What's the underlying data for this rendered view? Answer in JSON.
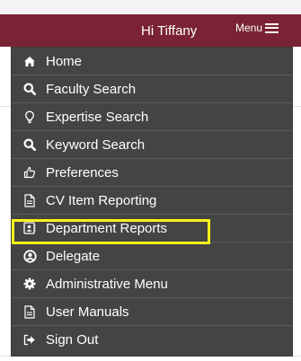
{
  "header": {
    "greeting": "Hi Tiffany",
    "menu_label": "Menu",
    "bar_color": "#7a2334"
  },
  "menu": {
    "highlight_color": "#f7f21a",
    "items": [
      {
        "label": "Home",
        "icon": "home-icon"
      },
      {
        "label": "Faculty Search",
        "icon": "search-icon"
      },
      {
        "label": "Expertise Search",
        "icon": "lightbulb-icon"
      },
      {
        "label": "Keyword Search",
        "icon": "search-icon"
      },
      {
        "label": "Preferences",
        "icon": "thumbs-up-icon"
      },
      {
        "label": "CV Item Reporting",
        "icon": "document-icon"
      },
      {
        "label": "Department Reports",
        "icon": "contact-card-icon",
        "highlighted": true
      },
      {
        "label": "Delegate",
        "icon": "user-circle-icon"
      },
      {
        "label": "Administrative Menu",
        "icon": "cog-icon"
      },
      {
        "label": "User Manuals",
        "icon": "document-icon"
      },
      {
        "label": "Sign Out",
        "icon": "sign-out-icon"
      }
    ]
  }
}
